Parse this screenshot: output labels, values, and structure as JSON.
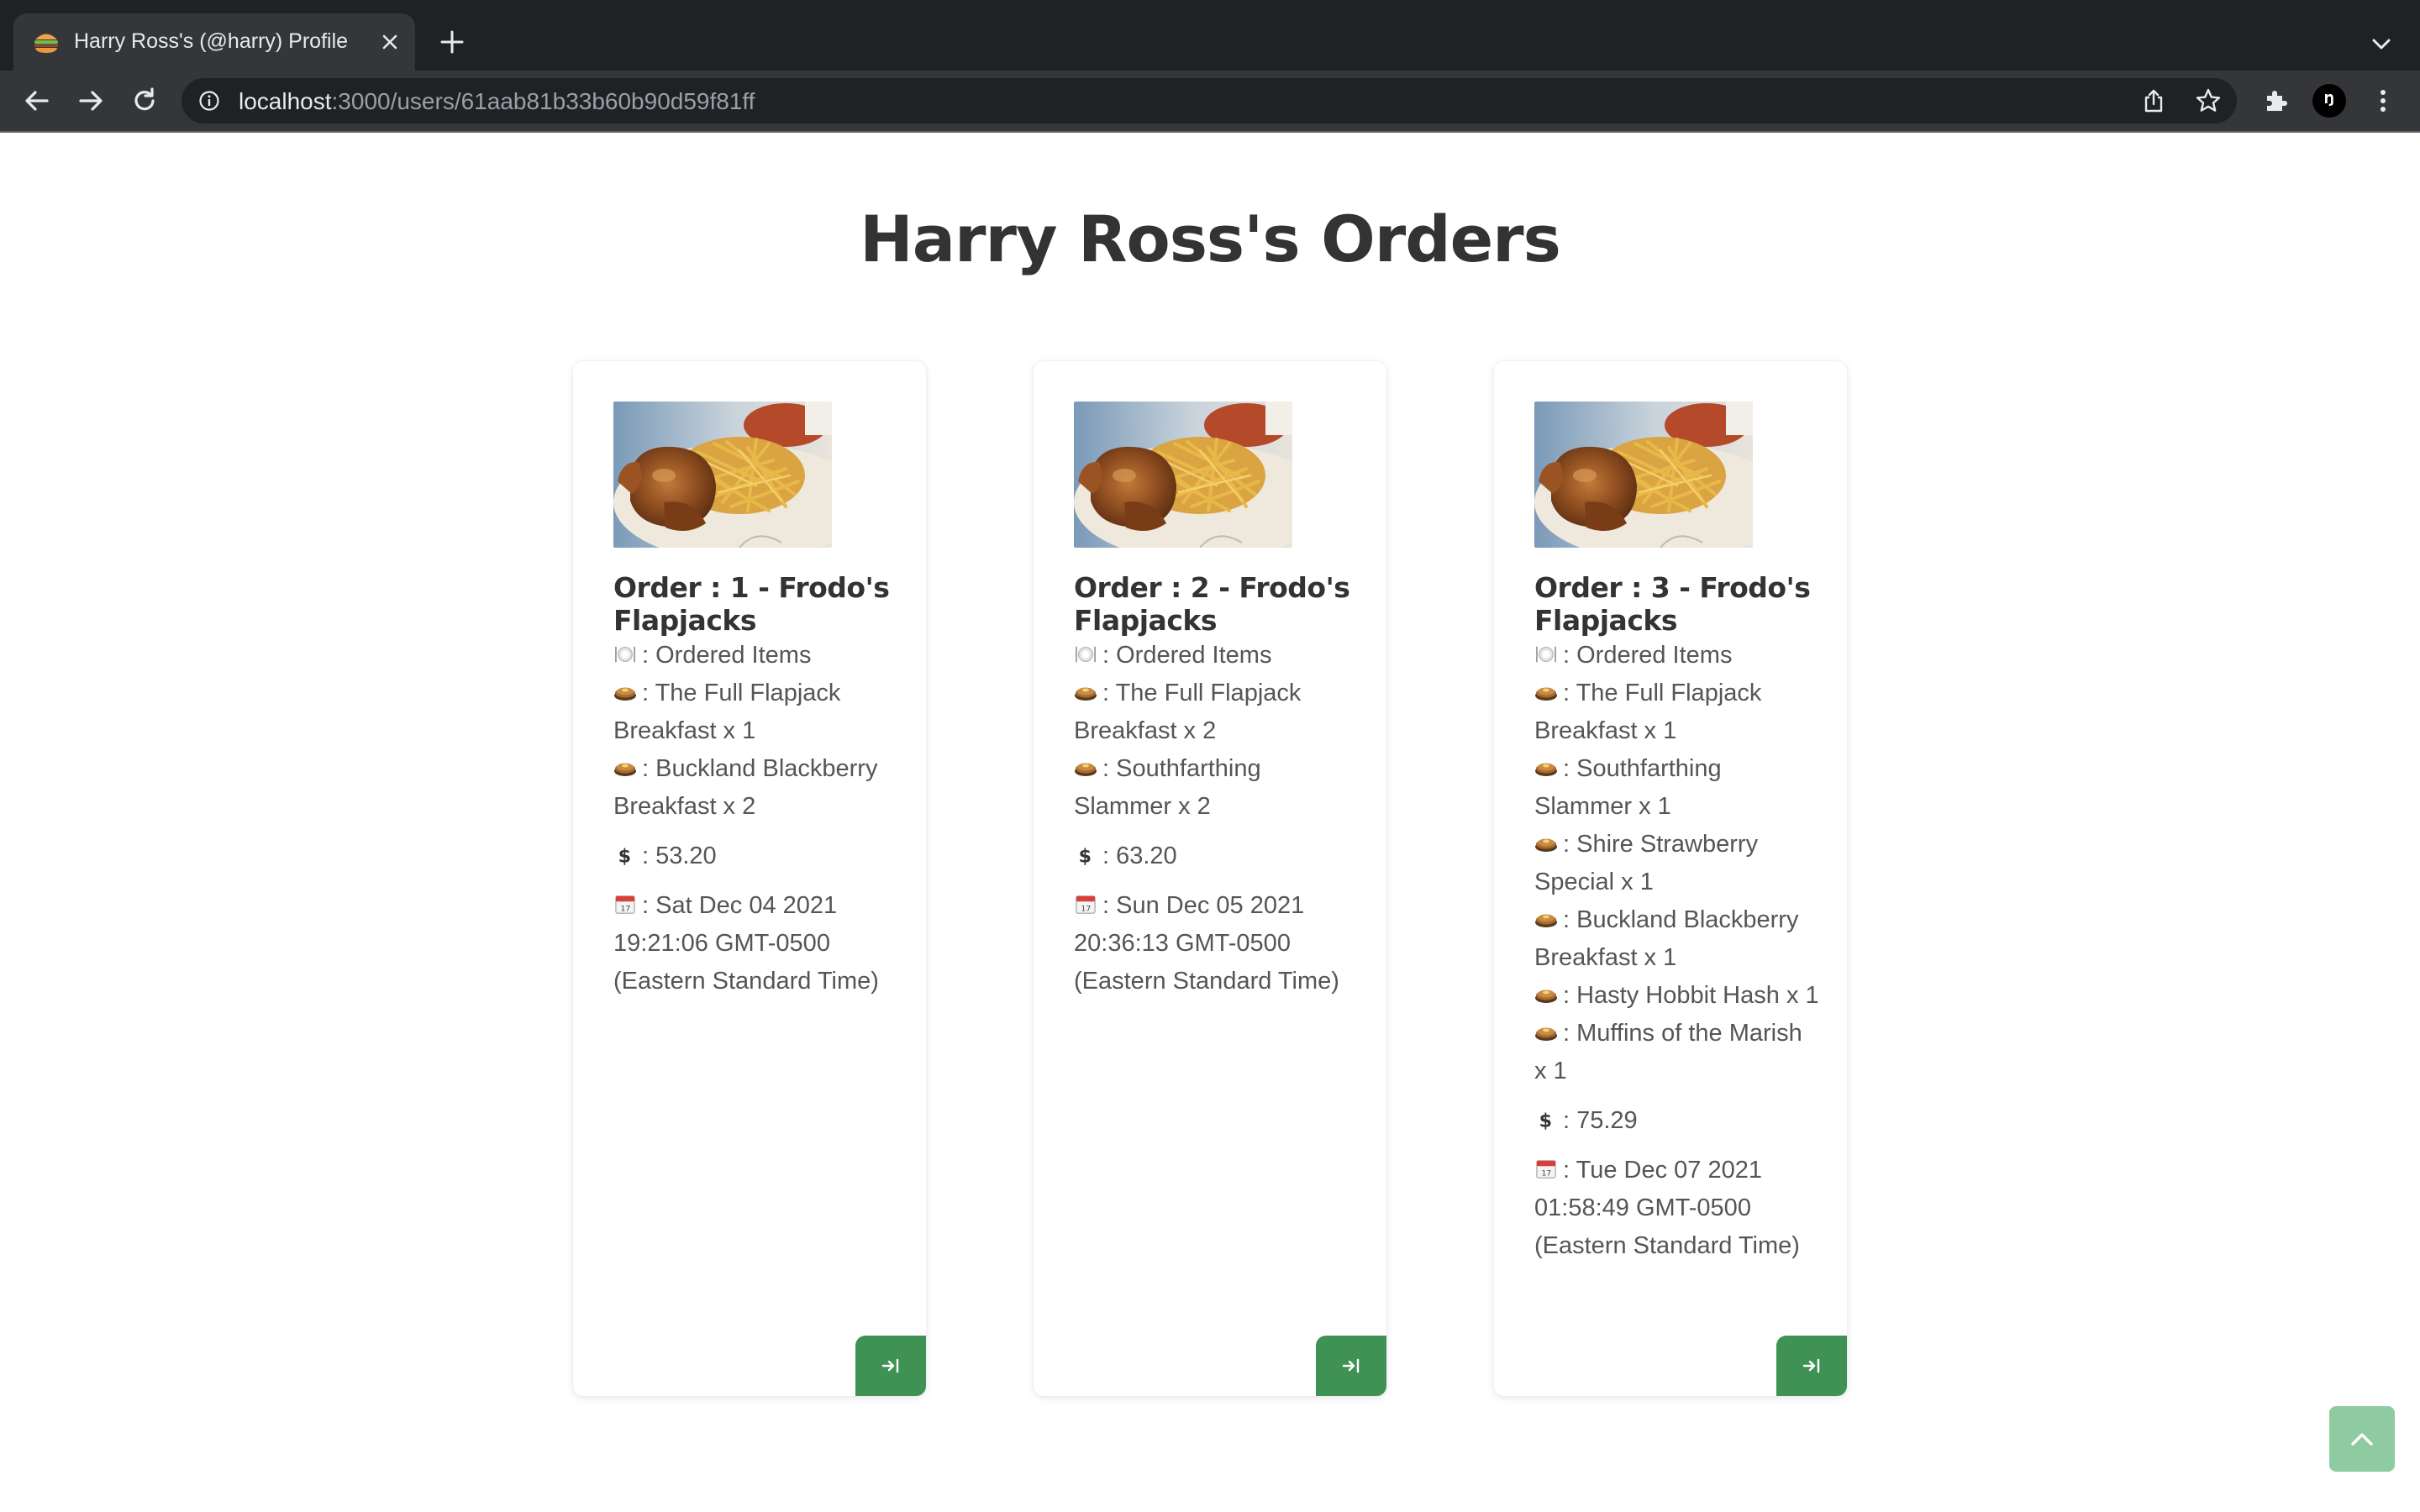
{
  "browser": {
    "tab_title": "Harry Ross's (@harry) Profile",
    "url_host": "localhost",
    "url_path": ":3000/users/61aab81b33b60b90d59f81ff",
    "profile_initial": "Ŋ"
  },
  "page": {
    "title": "Harry Ross's Orders"
  },
  "orders": [
    {
      "title": "Order : 1 - Frodo's Flapjacks",
      "items_label": ": Ordered Items",
      "items": [
        ": The Full Flapjack Breakfast x 1",
        ": Buckland Blackberry Breakfast x 2"
      ],
      "price": ": 53.20",
      "date": ": Sat Dec 04 2021 19:21:06 GMT-0500 (Eastern Standard Time)"
    },
    {
      "title": "Order : 2 - Frodo's Flapjacks",
      "items_label": ": Ordered Items",
      "items": [
        ": The Full Flapjack Breakfast x 2",
        ": Southfarthing Slammer x 2"
      ],
      "price": ": 63.20",
      "date": ": Sun Dec 05 2021 20:36:13 GMT-0500 (Eastern Standard Time)"
    },
    {
      "title": "Order : 3 - Frodo's Flapjacks",
      "items_label": ": Ordered Items",
      "items": [
        ": The Full Flapjack Breakfast x 1",
        ": Southfarthing Slammer x 1",
        ": Shire Strawberry Special x 1",
        ": Buckland Blackberry Breakfast x 1",
        ": Hasty Hobbit Hash x 1",
        ": Muffins of the Marish x 1"
      ],
      "price": ": 75.29",
      "date": ": Tue Dec 07 2021 01:58:49 GMT-0500 (Eastern Standard Time)"
    }
  ],
  "icons": {
    "items_label": "fork-knife-plate-icon",
    "item": "pancakes-icon",
    "price": "dollar-icon",
    "date": "calendar-icon",
    "open_order": "arrow-to-right-icon",
    "scroll_top": "chevron-up-icon"
  },
  "colors": {
    "accent_green": "#3f9253",
    "scroll_top_green": "#8fcba0",
    "chrome_dark": "#202124",
    "chrome_tab": "#35363a"
  }
}
